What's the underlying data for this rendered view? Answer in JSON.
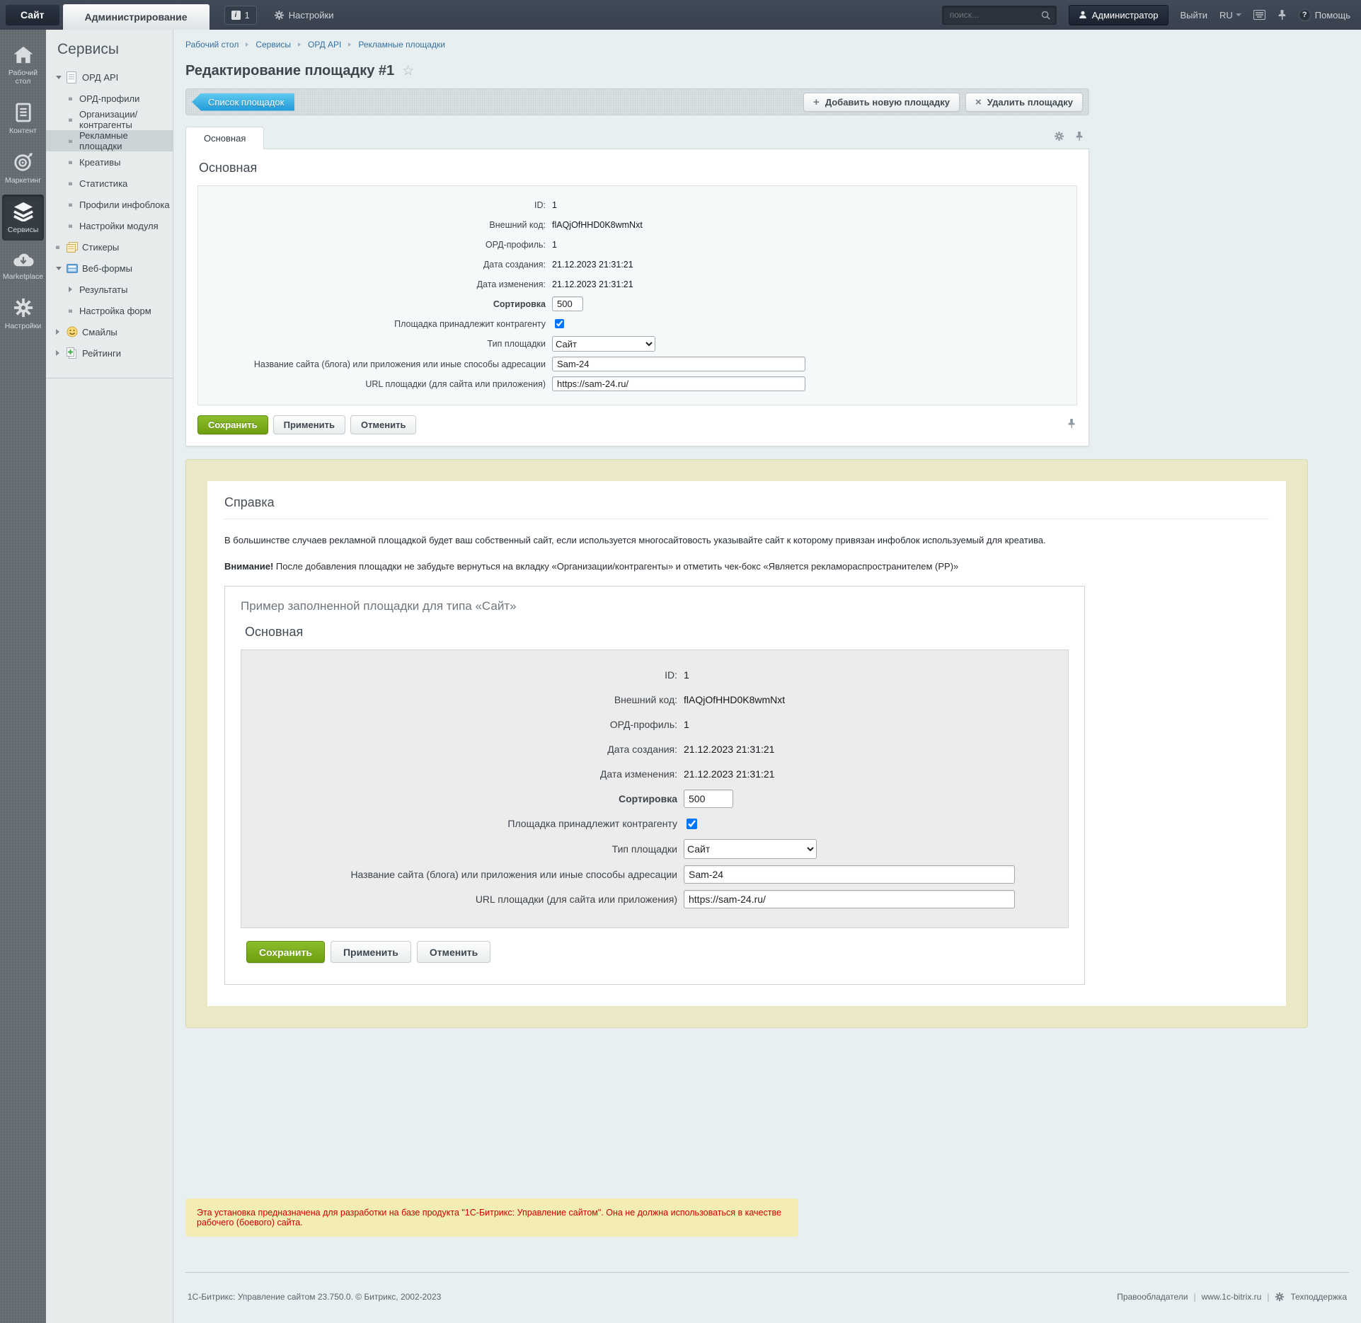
{
  "topbar": {
    "site_tab": "Сайт",
    "admin_tab": "Администрирование",
    "notification_count": "1",
    "settings_label": "Настройки",
    "search_placeholder": "поиск...",
    "user_label": "Администратор",
    "logout_label": "Выйти",
    "lang_label": "RU",
    "help_label": "Помощь"
  },
  "rail": {
    "items": [
      {
        "label": "Рабочий стол",
        "icon": "home-icon"
      },
      {
        "label": "Контент",
        "icon": "document-icon"
      },
      {
        "label": "Маркетинг",
        "icon": "target-icon"
      },
      {
        "label": "Сервисы",
        "icon": "layers-icon",
        "active": true
      },
      {
        "label": "Marketplace",
        "icon": "cloud-download-icon"
      },
      {
        "label": "Настройки",
        "icon": "gear-icon"
      }
    ]
  },
  "sidebar": {
    "title": "Сервисы",
    "tree": [
      {
        "label": "ОРД API",
        "level": 0,
        "state": "expanded",
        "icon": "document-icon"
      },
      {
        "label": "ОРД-профили",
        "level": 1
      },
      {
        "label": "Организации/контрагенты",
        "level": 1
      },
      {
        "label": "Рекламные площадки",
        "level": 1,
        "active": true
      },
      {
        "label": "Креативы",
        "level": 1
      },
      {
        "label": "Статистика",
        "level": 1
      },
      {
        "label": "Профили инфоблока",
        "level": 1
      },
      {
        "label": "Настройки модуля",
        "level": 1
      },
      {
        "label": "Стикеры",
        "level": 0,
        "icon": "sticker-icon"
      },
      {
        "label": "Веб-формы",
        "level": 0,
        "state": "expanded",
        "icon": "web-form-icon"
      },
      {
        "label": "Результаты",
        "level": 1,
        "state": "collapsed"
      },
      {
        "label": "Настройка форм",
        "level": 1
      },
      {
        "label": "Смайлы",
        "level": 0,
        "state": "collapsed",
        "icon": "smiley-icon"
      },
      {
        "label": "Рейтинги",
        "level": 0,
        "state": "collapsed",
        "icon": "rating-icon"
      }
    ]
  },
  "breadcrumb": {
    "items": [
      "Рабочий стол",
      "Сервисы",
      "ОРД API",
      "Рекламные площадки"
    ]
  },
  "page": {
    "title": "Редактирование площадку #1"
  },
  "toolbar": {
    "back_button": "Список площадок",
    "add_button": "Добавить новую площадку",
    "delete_button": "Удалить площадку"
  },
  "tabs": {
    "main": "Основная"
  },
  "form": {
    "section_title": "Основная",
    "static_rows": [
      {
        "label": "ID:",
        "value": "1"
      },
      {
        "label": "Внешний код:",
        "value": "flAQjOfHHD0K8wmNxt"
      },
      {
        "label": "ОРД-профиль:",
        "value": "1"
      },
      {
        "label": "Дата создания:",
        "value": "21.12.2023 21:31:21"
      },
      {
        "label": "Дата изменения:",
        "value": "21.12.2023 21:31:21"
      }
    ],
    "sort": {
      "label": "Сортировка",
      "value": "500"
    },
    "owner": {
      "label": "Площадка принадлежит контрагенту",
      "checked": true
    },
    "type": {
      "label": "Тип площадки",
      "value": "Сайт"
    },
    "site_name": {
      "label": "Название сайта (блога) или приложения или иные способы адресации",
      "value": "Sam-24"
    },
    "site_url": {
      "label": "URL площадки (для сайта или приложения)",
      "value": "https://sam-24.ru/"
    },
    "buttons": {
      "save": "Сохранить",
      "apply": "Применить",
      "cancel": "Отменить"
    }
  },
  "help": {
    "title": "Справка",
    "paragraph1": "В большинстве случаев рекламной площадкой будет ваш собственный сайт, если используется многосайтовость указывайте сайт к которому привязан инфоблок используемый для креатива.",
    "attention_label": "Внимание!",
    "attention_text": " После добавления площадки не забудьте вернуться на вкладку «Организации/контрагенты» и отметить чек-бокс «Является рекламораспространителем (РР)»",
    "example_title": "Пример заполненной площадки для типа «Сайт»"
  },
  "warning": {
    "text": "Эта установка предназначена для разработки на базе продукта \"1С-Битрикс: Управление сайтом\". Она не должна использоваться в качестве рабочего (боевого) сайта."
  },
  "footer": {
    "copyright": "1С-Битрикс: Управление сайтом 23.750.0. © Битрикс, 2002-2023",
    "link_rights": "Правообладатели",
    "link_site": "www.1c-bitrix.ru",
    "link_support": "Техподдержка"
  },
  "colors": {
    "accent_blue": "#2d9fd8",
    "save_green": "#74a213",
    "warning_red": "#cc0000",
    "topbar_dark": "#3b4450",
    "help_bg": "#ebe8c6"
  },
  "icons": {
    "search": "magnifier",
    "help": "question-circle",
    "favorite": "☆",
    "settings": "gear",
    "pin": "pushpin"
  }
}
